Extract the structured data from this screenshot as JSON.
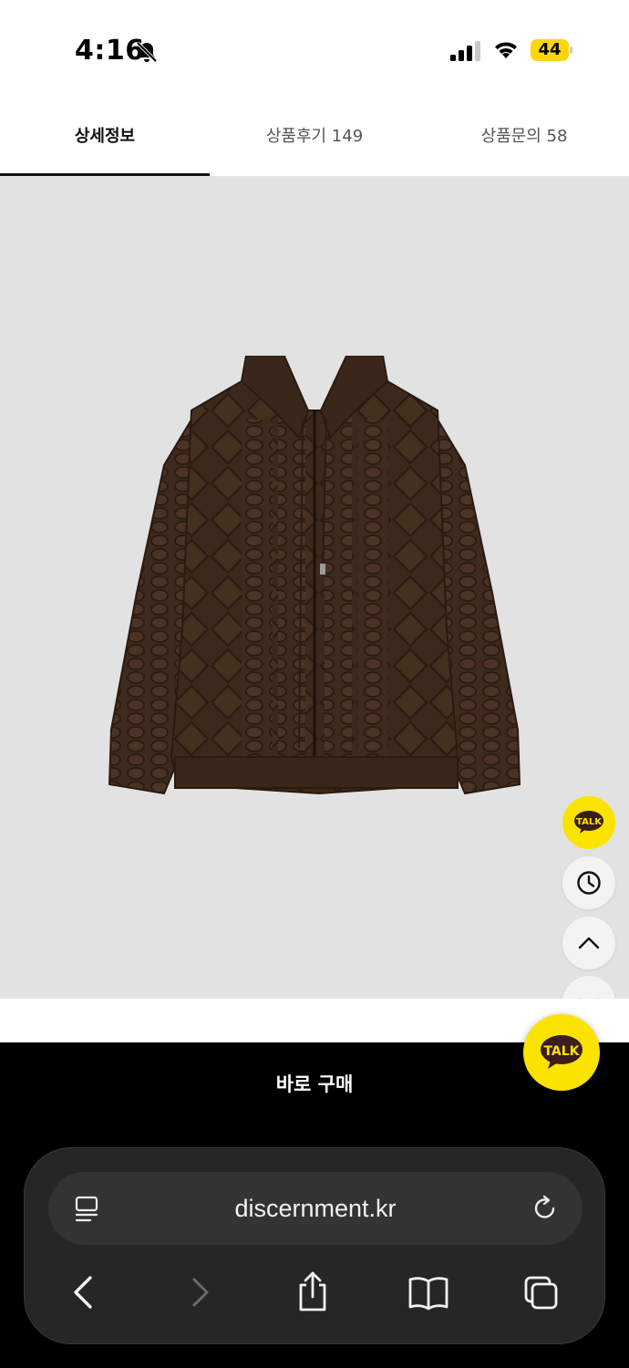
{
  "status_bar": {
    "time": "4:16",
    "battery": "44",
    "icons": [
      "bell-off-icon",
      "signal-icon",
      "wifi-icon",
      "battery-icon"
    ]
  },
  "tabs": [
    {
      "label": "상세정보",
      "active": true
    },
    {
      "label": "상품후기 149",
      "active": false
    },
    {
      "label": "상품문의 58",
      "active": false
    }
  ],
  "product": {
    "image": "brown-cable-knit-hooded-zip-cardigan",
    "background_color": "#e2e2e2"
  },
  "floating_buttons": {
    "talk_label": "TALK",
    "icons": [
      "kakao-talk-icon",
      "clock-icon",
      "chevron-up-icon",
      "chevron-down-icon"
    ]
  },
  "buy_bar": {
    "label": "바로 구매"
  },
  "kakao_fab": {
    "label": "TALK",
    "color": "#fbe300"
  },
  "browser": {
    "url": "discernment.kr",
    "icons": [
      "reader-icon",
      "reload-icon",
      "back-icon",
      "forward-icon",
      "share-icon",
      "bookmarks-icon",
      "tabs-icon"
    ]
  }
}
